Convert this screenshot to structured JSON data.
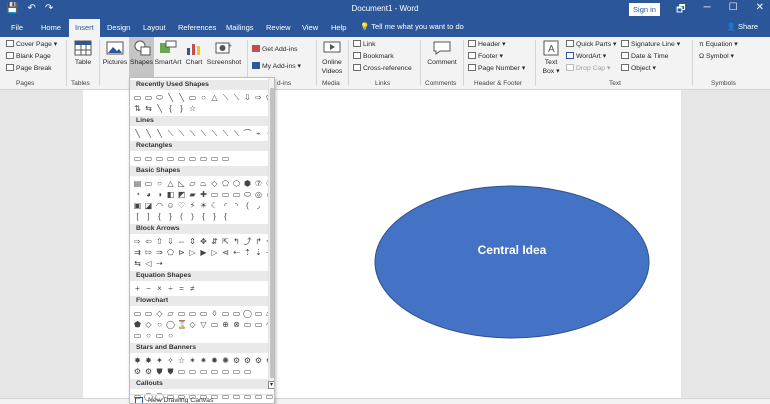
{
  "titlebar": {
    "title": "Document1 - Word",
    "signin": "Sign in",
    "qat": [
      "💾",
      "↶",
      "↷"
    ],
    "win": [
      "🗗",
      "─",
      "☐",
      "✕"
    ]
  },
  "tabs": [
    "File",
    "Home",
    "Insert",
    "Design",
    "Layout",
    "References",
    "Mailings",
    "Review",
    "View",
    "Help"
  ],
  "tell_me": "Tell me what you want to do",
  "share": "Share",
  "ribbon": {
    "pages": {
      "items": [
        "Cover Page ▾",
        "Blank Page",
        "Page Break"
      ],
      "label": "Pages"
    },
    "tables": {
      "button": "Table",
      "label": "Tables"
    },
    "illustrations": {
      "pictures": "Pictures",
      "shapes": "Shapes",
      "smartart": "SmartArt",
      "chart": "Chart",
      "screenshot": "Screenshot"
    },
    "addins": {
      "get": "Get Add-ins",
      "my": "My Add-ins ▾",
      "label": "d-ins"
    },
    "media": {
      "online_videos_1": "Online",
      "online_videos_2": "Videos",
      "label": "Media"
    },
    "links": {
      "items": [
        "Link",
        "Bookmark",
        "Cross-reference"
      ],
      "label": "Links"
    },
    "comments": {
      "button": "Comment",
      "label": "Comments"
    },
    "header_footer": {
      "items": [
        "Header ▾",
        "Footer ▾",
        "Page Number ▾"
      ],
      "label": "Header & Footer"
    },
    "text": {
      "textbox_1": "Text",
      "textbox_2": "Box ▾",
      "items": [
        "Quick Parts ▾",
        "WordArt ▾",
        "Drop Cap ▾"
      ],
      "items2": [
        "Signature Line ▾",
        "Date & Time",
        "Object ▾"
      ],
      "label": "Text"
    },
    "symbols": {
      "items": [
        "Equation ▾",
        "Symbol ▾"
      ],
      "label": "Symbols"
    }
  },
  "shapes_gallery": {
    "sections": [
      {
        "title": "Recently Used Shapes",
        "rows": [
          [
            "▭",
            "▭",
            "⬭",
            "╲",
            "╲",
            "▭",
            "○",
            "△",
            "⟍",
            "⟍",
            "⇩",
            "⇨",
            "⬠",
            "⬡"
          ],
          [
            "⇅",
            "⇆",
            "╲",
            "{",
            "}",
            "☆"
          ]
        ]
      },
      {
        "title": "Lines",
        "rows": [
          [
            "╲",
            "╲",
            "╲",
            "⟍",
            "⟍",
            "⟍",
            "⟍",
            "⟍",
            "⟍",
            "⟍",
            "⌒",
            "⌁",
            "⌁"
          ]
        ]
      },
      {
        "title": "Rectangles",
        "rows": [
          [
            "▭",
            "▭",
            "▭",
            "▭",
            "▭",
            "▭",
            "▭",
            "▭",
            "▭"
          ]
        ]
      },
      {
        "title": "Basic Shapes",
        "rows": [
          [
            "▤",
            "▭",
            "○",
            "△",
            "◺",
            "▱",
            "⏢",
            "◇",
            "⬠",
            "⬡",
            "⬢",
            "⑦",
            "⑧",
            "⑩"
          ],
          [
            "◔",
            "◕",
            "◑",
            "◧",
            "◩",
            "▰",
            "✚",
            "▭",
            "▭",
            "▭",
            "⬭",
            "◎",
            "⦸",
            "◫"
          ],
          [
            "▣",
            "◪",
            "◠",
            "☺",
            "♡",
            "⚡",
            "☀",
            "☾",
            "◜",
            "◝",
            "(",
            "◞"
          ],
          [
            "[",
            "]",
            "{",
            "}",
            "(",
            ")",
            "{",
            "}",
            "{"
          ]
        ]
      },
      {
        "title": "Block Arrows",
        "rows": [
          [
            "⇨",
            "⇦",
            "⇧",
            "⇩",
            "⇔",
            "⇕",
            "✥",
            "⇵",
            "⇱",
            "↰",
            "⤴",
            "↱",
            "⟲",
            "⤵"
          ],
          [
            "⇉",
            "⇰",
            "⇒",
            "⬠",
            "⊳",
            "▷",
            "▶",
            "▷",
            "⊲",
            "⇠",
            "⇡",
            "⇣",
            "⇢"
          ],
          [
            "⇆",
            "◁",
            "⇢"
          ]
        ]
      },
      {
        "title": "Equation Shapes",
        "rows": [
          [
            "+",
            "−",
            "×",
            "÷",
            "=",
            "≠"
          ]
        ]
      },
      {
        "title": "Flowchart",
        "rows": [
          [
            "▭",
            "▭",
            "◇",
            "▱",
            "▭",
            "▭",
            "▭",
            "◊",
            "▭",
            "▭",
            "◯",
            "▭",
            "⏢",
            "⌂"
          ],
          [
            "⬟",
            "◇",
            "○",
            "◯",
            "⌛",
            "◇",
            "▽",
            "▭",
            "⊕",
            "⊗",
            "▭",
            "▭",
            "◠",
            "○"
          ],
          [
            "▭",
            "○",
            "▭",
            "○"
          ]
        ]
      },
      {
        "title": "Stars and Banners",
        "rows": [
          [
            "✸",
            "✸",
            "✦",
            "✧",
            "☆",
            "✶",
            "✷",
            "✹",
            "✺",
            "⚙",
            "⚙",
            "⚙",
            "⚙",
            "⚙"
          ],
          [
            "⚙",
            "⚙",
            "⛊",
            "⛊",
            "▭",
            "▭",
            "▭",
            "▭",
            "▭",
            "▭",
            "▭"
          ]
        ]
      },
      {
        "title": "Callouts",
        "rows": [
          [
            "▭",
            "◯",
            "◯",
            "▭",
            "▭",
            "▭",
            "▭",
            "▭",
            "▭",
            "▭",
            "▭",
            "▭",
            "▭",
            "▭"
          ]
        ]
      }
    ],
    "footer": "New Drawing Canvas"
  },
  "document": {
    "ellipse_text": "Central Idea",
    "ellipse_color": "#4472c4"
  }
}
